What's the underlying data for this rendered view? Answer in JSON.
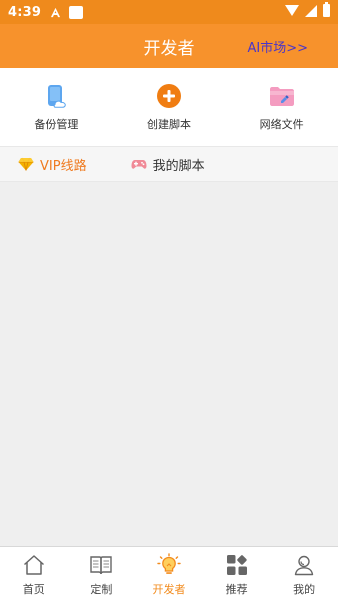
{
  "status_bar": {
    "time": "4:39"
  },
  "header": {
    "title": "开发者",
    "link": "AI市场>>"
  },
  "quick_actions": [
    {
      "label": "备份管理",
      "icon": "phone-cloud-icon"
    },
    {
      "label": "创建脚本",
      "icon": "add-circle-icon"
    },
    {
      "label": "网络文件",
      "icon": "folder-edit-icon"
    }
  ],
  "lines": {
    "vip": "VIP线路",
    "mine": "我的脚本"
  },
  "tabs": [
    {
      "label": "首页",
      "icon": "home-icon"
    },
    {
      "label": "定制",
      "icon": "book-icon"
    },
    {
      "label": "开发者",
      "icon": "lightbulb-icon",
      "active": true
    },
    {
      "label": "推荐",
      "icon": "grid-icon"
    },
    {
      "label": "我的",
      "icon": "user-icon"
    }
  ],
  "colors": {
    "header_bg": "#f7922c",
    "statusbar_bg": "#ef8a1c",
    "accent": "#ef7a1f",
    "link": "#4a35c9"
  }
}
